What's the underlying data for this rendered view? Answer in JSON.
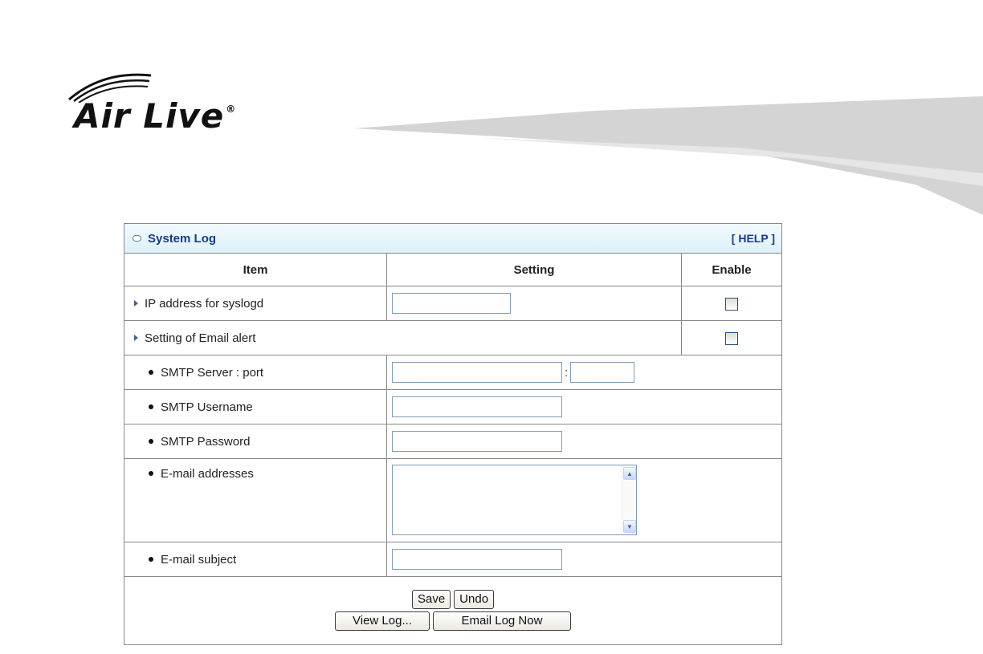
{
  "brand": {
    "logo_text": "Air Live",
    "registered_mark": "®"
  },
  "panel": {
    "title": "System Log",
    "help_label": "[ HELP ]"
  },
  "table": {
    "headers": {
      "item": "Item",
      "setting": "Setting",
      "enable": "Enable"
    },
    "rows": {
      "syslogd_label": "IP address for syslogd",
      "syslogd_value": "",
      "syslogd_enabled": false,
      "email_alert_label": "Setting of Email alert",
      "email_alert_enabled": false,
      "smtp_server_label": "SMTP Server : port",
      "smtp_server_value": "",
      "smtp_port_separator": ":",
      "smtp_port_value": "",
      "smtp_username_label": "SMTP Username",
      "smtp_username_value": "",
      "smtp_password_label": "SMTP Password",
      "smtp_password_value": "",
      "email_addresses_label": "E-mail addresses",
      "email_addresses_value": "",
      "email_subject_label": "E-mail subject",
      "email_subject_value": ""
    }
  },
  "buttons": {
    "save": "Save",
    "undo": "Undo",
    "view_log": "View Log...",
    "email_log_now": "Email Log Now"
  },
  "colors": {
    "header_text": "#1a3a8c",
    "header_bg_top": "#f3fbfe",
    "header_bg_bottom": "#dcf1f8",
    "border": "#888888",
    "input_border": "#7f9db9"
  }
}
